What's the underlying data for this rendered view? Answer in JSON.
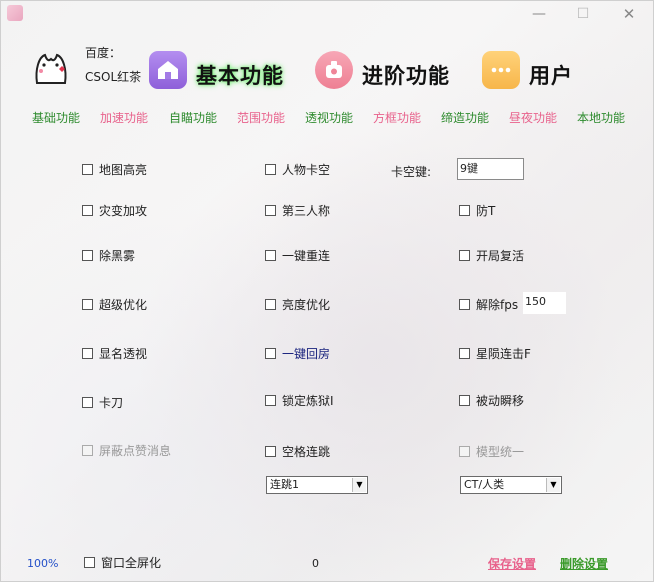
{
  "window": {
    "minimize": "—",
    "maximize": "☐",
    "close": "✕"
  },
  "header": {
    "baidu_label": "百度：",
    "baidu_name": "CSOL红茶",
    "tabs": [
      {
        "label": "基本功能",
        "icon": "home-icon"
      },
      {
        "label": "进阶功能",
        "icon": "camera-icon"
      },
      {
        "label": "用户",
        "icon": "more-dots-icon"
      }
    ]
  },
  "subnav": {
    "items": [
      {
        "label": "基础功能",
        "color": "#2e8b2e"
      },
      {
        "label": "加速功能",
        "color": "#e8628c"
      },
      {
        "label": "自瞄功能",
        "color": "#2e8b2e"
      },
      {
        "label": "范围功能",
        "color": "#e8628c"
      },
      {
        "label": "透视功能",
        "color": "#2e8b2e"
      },
      {
        "label": "方框功能",
        "color": "#e8628c"
      },
      {
        "label": "缔造功能",
        "color": "#2e8b2e"
      },
      {
        "label": "昼夜功能",
        "color": "#e8628c"
      },
      {
        "label": "本地功能",
        "color": "#2e8b2e"
      }
    ]
  },
  "options": {
    "col1": [
      "地图高亮",
      "灾变加攻",
      "除黑雾",
      "超级优化",
      "显名透视",
      "卡刀",
      "屏蔽点赞消息"
    ],
    "col2": [
      "人物卡空",
      "第三人称",
      "一键重连",
      "亮度优化",
      "一键回房",
      "锁定炼狱I",
      "空格连跳"
    ],
    "col3": [
      "防T",
      "开局复活",
      "解除fps",
      "星陨连击F",
      "被动瞬移",
      "模型统一"
    ]
  },
  "fields": {
    "kakong_label": "卡空键:",
    "kakong_value": "9键",
    "fps_value": "150"
  },
  "selects": {
    "jump": "连跳1",
    "model": "CT/人类"
  },
  "footer": {
    "zoom": "100%",
    "fullscreen_label": "窗口全屏化",
    "counter": "0",
    "save": "保存设置",
    "delete": "删除设置"
  }
}
